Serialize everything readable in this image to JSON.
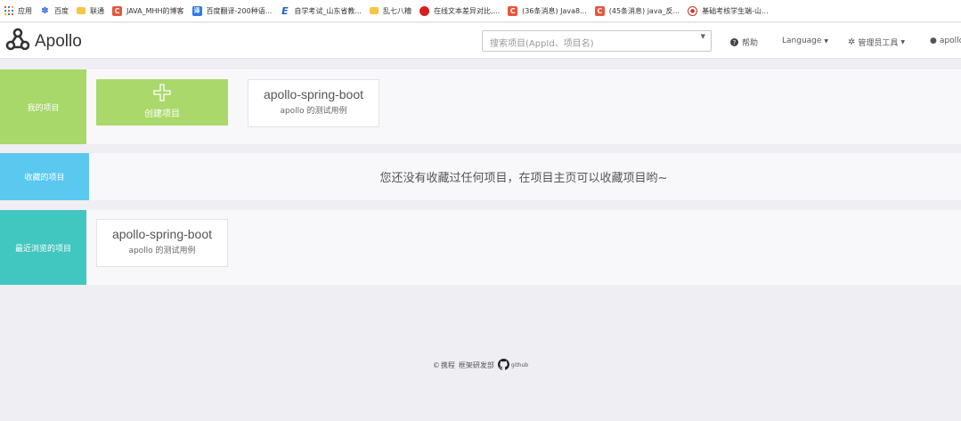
{
  "bookmarks": [
    {
      "label": "应用",
      "icon": "apps-grid-icon",
      "color": "#e8553d"
    },
    {
      "label": "百度",
      "icon": "baidu-paw-icon",
      "color": "#2d63d8"
    },
    {
      "label": "联通",
      "icon": "folder-icon",
      "color": "#f5c543"
    },
    {
      "label": "JAVA_MHH的博客",
      "icon": "csdn-c-icon",
      "color": "#e8553d"
    },
    {
      "label": "百度翻译-200种语...",
      "icon": "translate-icon",
      "color": "#2d7be8"
    },
    {
      "label": "自学考试_山东省教...",
      "icon": "e-logo-icon",
      "color": "#2062c7"
    },
    {
      "label": "乱七八糟",
      "icon": "folder-icon",
      "color": "#f5c543"
    },
    {
      "label": "在线文本差异对比,...",
      "icon": "diff-icon",
      "color": "#d32020"
    },
    {
      "label": "(36条消息) Java8...",
      "icon": "csdn-c-icon",
      "color": "#e8553d"
    },
    {
      "label": "(45条消息) java_反...",
      "icon": "csdn-c-icon",
      "color": "#e8553d"
    },
    {
      "label": "基础考核学生端-山...",
      "icon": "seal-icon",
      "color": "#c0392b"
    }
  ],
  "navbar": {
    "brand": "Apollo",
    "search_placeholder": "搜索项目(AppId、项目名)",
    "help": "帮助",
    "language": "Language",
    "admin_tools": "管理员工具",
    "user": "apollo"
  },
  "sections": {
    "my_projects": {
      "label": "我的项目",
      "color": "#a8d76a"
    },
    "favorites": {
      "label": "收藏的项目",
      "color": "#5bc8f0"
    },
    "recent": {
      "label": "最近浏览的项目",
      "color": "#41c6c0"
    }
  },
  "create_project": {
    "label": "创建项目"
  },
  "my_apps": [
    {
      "name": "apollo-spring-boot",
      "desc": "apollo 的测试用例"
    }
  ],
  "favorites_empty": "您还没有收藏过任何项目，在项目主页可以收藏项目哟~",
  "recent_apps": [
    {
      "name": "apollo-spring-boot",
      "desc": "apollo 的测试用例"
    }
  ],
  "footer": {
    "company": "携程",
    "team": "框架研发部",
    "github": "github"
  }
}
